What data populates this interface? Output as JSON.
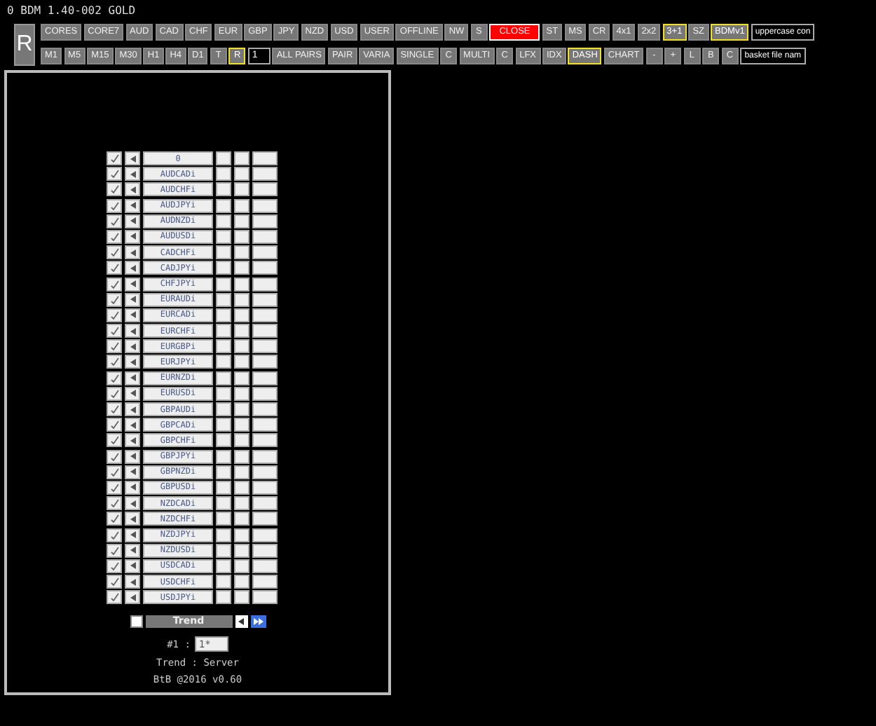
{
  "window": {
    "title": "0 BDM 1.40-002 GOLD"
  },
  "reset_button": {
    "label": "R"
  },
  "toolbar_row_1": [
    {
      "label": "CORES",
      "kind": "normal",
      "selected": false
    },
    {
      "label": "CORE7",
      "kind": "normal",
      "selected": false
    },
    {
      "label": "AUD",
      "kind": "normal",
      "selected": false
    },
    {
      "label": "CAD",
      "kind": "normal",
      "selected": false
    },
    {
      "label": "CHF",
      "kind": "normal",
      "selected": false
    },
    {
      "label": "EUR",
      "kind": "normal",
      "selected": false
    },
    {
      "label": "GBP",
      "kind": "normal",
      "selected": false
    },
    {
      "label": "JPY",
      "kind": "normal",
      "selected": false
    },
    {
      "label": "NZD",
      "kind": "normal",
      "selected": false
    },
    {
      "label": "USD",
      "kind": "normal",
      "selected": false
    },
    {
      "label": "USER",
      "kind": "normal",
      "selected": false
    },
    {
      "label": "OFFLINE",
      "kind": "normal",
      "selected": false
    },
    {
      "label": "NW",
      "kind": "normal",
      "selected": false
    },
    {
      "label": "S",
      "kind": "normal",
      "selected": false
    },
    {
      "label": "CLOSE",
      "kind": "danger",
      "selected": false
    },
    {
      "label": "ST",
      "kind": "normal",
      "selected": false
    },
    {
      "label": "MS",
      "kind": "normal",
      "selected": false
    },
    {
      "label": "CR",
      "kind": "normal",
      "selected": false
    },
    {
      "label": "4x1",
      "kind": "normal",
      "selected": false
    },
    {
      "label": "2x2",
      "kind": "normal",
      "selected": false
    },
    {
      "label": "3+1",
      "kind": "normal",
      "selected": true
    },
    {
      "label": "SZ",
      "kind": "normal",
      "selected": false
    },
    {
      "label": "BDMv1",
      "kind": "normal",
      "selected": true
    },
    {
      "value": "uppercase con",
      "kind": "input"
    }
  ],
  "toolbar_row_2": [
    {
      "label": "M1",
      "kind": "normal",
      "selected": false
    },
    {
      "label": "M5",
      "kind": "normal",
      "selected": false
    },
    {
      "label": "M15",
      "kind": "normal",
      "selected": false
    },
    {
      "label": "M30",
      "kind": "normal",
      "selected": false
    },
    {
      "label": "H1",
      "kind": "normal",
      "selected": false
    },
    {
      "label": "H4",
      "kind": "normal",
      "selected": false
    },
    {
      "label": "D1",
      "kind": "normal",
      "selected": false
    },
    {
      "label": "T",
      "kind": "normal",
      "selected": false
    },
    {
      "label": "R",
      "kind": "normal",
      "selected": true
    },
    {
      "value": "1",
      "kind": "input"
    },
    {
      "label": "ALL PAIRS",
      "kind": "normal",
      "selected": false
    },
    {
      "label": "PAIR",
      "kind": "normal",
      "selected": false
    },
    {
      "label": "VARIA",
      "kind": "normal",
      "selected": false
    },
    {
      "label": "SINGLE",
      "kind": "normal",
      "selected": false
    },
    {
      "label": "C",
      "kind": "normal",
      "selected": false
    },
    {
      "label": "MULTI",
      "kind": "normal",
      "selected": false
    },
    {
      "label": "C",
      "kind": "normal",
      "selected": false
    },
    {
      "label": "LFX",
      "kind": "normal",
      "selected": false
    },
    {
      "label": "IDX",
      "kind": "normal",
      "selected": false
    },
    {
      "label": "DASH",
      "kind": "normal",
      "selected": true
    },
    {
      "label": "CHART",
      "kind": "normal",
      "selected": false
    },
    {
      "label": "-",
      "kind": "normal",
      "selected": false
    },
    {
      "label": "+",
      "kind": "normal",
      "selected": false
    },
    {
      "label": "L",
      "kind": "normal",
      "selected": false
    },
    {
      "label": "B",
      "kind": "normal",
      "selected": false
    },
    {
      "label": "C",
      "kind": "normal",
      "selected": false
    },
    {
      "value": "basket file nam",
      "kind": "input"
    }
  ],
  "pairs_table": {
    "rows": [
      {
        "name": "0"
      },
      {
        "name": "AUDCADi"
      },
      {
        "name": "AUDCHFi"
      },
      {
        "name": "AUDJPYi"
      },
      {
        "name": "AUDNZDi"
      },
      {
        "name": "AUDUSDi"
      },
      {
        "name": "CADCHFi"
      },
      {
        "name": "CADJPYi"
      },
      {
        "name": "CHFJPYi"
      },
      {
        "name": "EURAUDi"
      },
      {
        "name": "EURCADi"
      },
      {
        "name": "EURCHFi"
      },
      {
        "name": "EURGBPi"
      },
      {
        "name": "EURJPYi"
      },
      {
        "name": "EURNZDi"
      },
      {
        "name": "EURUSDi"
      },
      {
        "name": "GBPAUDi"
      },
      {
        "name": "GBPCADi"
      },
      {
        "name": "GBPCHFi"
      },
      {
        "name": "GBPJPYi"
      },
      {
        "name": "GBPNZDi"
      },
      {
        "name": "GBPUSDi"
      },
      {
        "name": "NZDCADi"
      },
      {
        "name": "NZDCHFi"
      },
      {
        "name": "NZDJPYi"
      },
      {
        "name": "NZDUSDi"
      },
      {
        "name": "USDCADi"
      },
      {
        "name": "USDCHFi"
      },
      {
        "name": "USDJPYi"
      }
    ]
  },
  "mode_bar": {
    "checked": false,
    "label": "Trend"
  },
  "index_label": "#1 :",
  "index_value": "1*",
  "status_line": "Trend : Server",
  "footer": "BtB @2016 v0.60"
}
